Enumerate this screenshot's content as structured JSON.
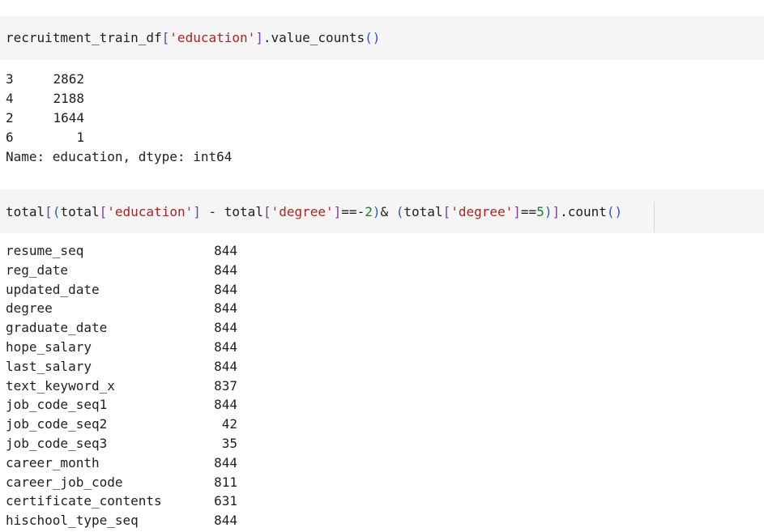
{
  "cells": [
    {
      "input": {
        "tokens": [
          {
            "cls": "tok-name",
            "text": "recruitment_train_df"
          },
          {
            "cls": "tok-bracket",
            "text": "["
          },
          {
            "cls": "tok-str",
            "text": "'education'"
          },
          {
            "cls": "tok-bracket",
            "text": "]"
          },
          {
            "cls": "tok-name",
            "text": ".value_counts"
          },
          {
            "cls": "tok-paren",
            "text": "()"
          }
        ]
      },
      "output": {
        "rows": [
          {
            "index": "3",
            "count": "2862"
          },
          {
            "index": "4",
            "count": "2188"
          },
          {
            "index": "2",
            "count": "1644"
          },
          {
            "index": "6",
            "count": "1"
          }
        ],
        "footer": "Name: education, dtype: int64"
      }
    },
    {
      "input": {
        "tokens": [
          {
            "cls": "tok-name",
            "text": "total"
          },
          {
            "cls": "tok-bracket",
            "text": "["
          },
          {
            "cls": "tok-paren",
            "text": "("
          },
          {
            "cls": "tok-name",
            "text": "total"
          },
          {
            "cls": "tok-bracket",
            "text": "["
          },
          {
            "cls": "tok-str",
            "text": "'education'"
          },
          {
            "cls": "tok-bracket",
            "text": "]"
          },
          {
            "cls": "tok-op",
            "text": " - "
          },
          {
            "cls": "tok-name",
            "text": "total"
          },
          {
            "cls": "tok-bracket",
            "text": "["
          },
          {
            "cls": "tok-str",
            "text": "'degree'"
          },
          {
            "cls": "tok-bracket",
            "text": "]"
          },
          {
            "cls": "tok-op",
            "text": "==-"
          },
          {
            "cls": "tok-num",
            "text": "2"
          },
          {
            "cls": "tok-paren",
            "text": ")"
          },
          {
            "cls": "tok-op",
            "text": "& "
          },
          {
            "cls": "tok-paren",
            "text": "("
          },
          {
            "cls": "tok-name",
            "text": "total"
          },
          {
            "cls": "tok-bracket",
            "text": "["
          },
          {
            "cls": "tok-str",
            "text": "'degree'"
          },
          {
            "cls": "tok-bracket",
            "text": "]"
          },
          {
            "cls": "tok-op",
            "text": "=="
          },
          {
            "cls": "tok-num",
            "text": "5"
          },
          {
            "cls": "tok-paren",
            "text": ")"
          },
          {
            "cls": "tok-bracket",
            "text": "]"
          },
          {
            "cls": "tok-name",
            "text": ".count"
          },
          {
            "cls": "tok-paren",
            "text": "()"
          }
        ]
      },
      "output": {
        "rows": [
          {
            "key": "resume_seq",
            "value": "844"
          },
          {
            "key": "reg_date",
            "value": "844"
          },
          {
            "key": "updated_date",
            "value": "844"
          },
          {
            "key": "degree",
            "value": "844"
          },
          {
            "key": "graduate_date",
            "value": "844"
          },
          {
            "key": "hope_salary",
            "value": "844"
          },
          {
            "key": "last_salary",
            "value": "844"
          },
          {
            "key": "text_keyword_x",
            "value": "837"
          },
          {
            "key": "job_code_seq1",
            "value": "844"
          },
          {
            "key": "job_code_seq2",
            "value": "42"
          },
          {
            "key": "job_code_seq3",
            "value": "35"
          },
          {
            "key": "career_month",
            "value": "844"
          },
          {
            "key": "career_job_code",
            "value": "811"
          },
          {
            "key": "certificate_contents",
            "value": "631"
          },
          {
            "key": "hischool_type_seq",
            "value": "844"
          }
        ]
      }
    }
  ]
}
